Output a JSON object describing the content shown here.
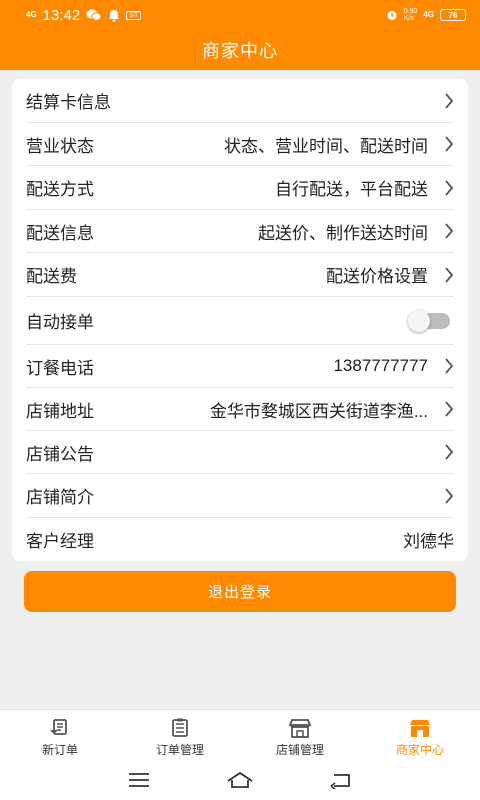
{
  "statusbar": {
    "network": "4G",
    "time": "13:42",
    "app_badge": "ST",
    "speed": "0.90",
    "speed_unit": "K/s",
    "right_network": "4G",
    "battery": "76"
  },
  "header": {
    "title": "商家中心"
  },
  "menu": {
    "settlement_card": {
      "label": "结算卡信息",
      "value": ""
    },
    "business_status": {
      "label": "营业状态",
      "value": "状态、营业时间、配送时间"
    },
    "delivery_method": {
      "label": "配送方式",
      "value": "自行配送，平台配送"
    },
    "delivery_info": {
      "label": "配送信息",
      "value": "起送价、制作送达时间"
    },
    "delivery_fee": {
      "label": "配送费",
      "value": "配送价格设置"
    },
    "auto_accept": {
      "label": "自动接单",
      "enabled": false
    },
    "order_phone": {
      "label": "订餐电话",
      "value": "1387777777"
    },
    "store_address": {
      "label": "店铺地址",
      "value": "金华市婺城区西关街道李渔..."
    },
    "store_notice": {
      "label": "店铺公告",
      "value": ""
    },
    "store_intro": {
      "label": "店铺简介",
      "value": ""
    },
    "account_manager": {
      "label": "客户经理",
      "value": "刘德华"
    }
  },
  "logout": {
    "label": "退出登录"
  },
  "tabs": [
    {
      "label": "新订单",
      "icon": "new-order-icon",
      "active": false
    },
    {
      "label": "订单管理",
      "icon": "order-list-icon",
      "active": false
    },
    {
      "label": "店铺管理",
      "icon": "store-icon",
      "active": false
    },
    {
      "label": "商家中心",
      "icon": "merchant-center-icon",
      "active": true
    }
  ],
  "colors": {
    "accent": "#ff8a00",
    "background": "#efefef",
    "card": "#ffffff",
    "text": "#222222"
  }
}
